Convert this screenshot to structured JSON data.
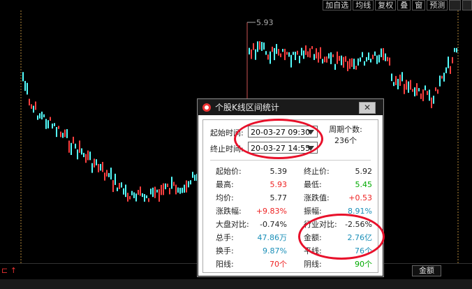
{
  "toolbar": {
    "items": [
      "加自选",
      "均线",
      "复权",
      "叠",
      "窗",
      "预测"
    ],
    "arrow_glyph": "⇒",
    "dropdown_glyph": "▾"
  },
  "chart": {
    "high_label": "5.93",
    "up_color": "#ff4040",
    "down_color": "#54ffff"
  },
  "dialog": {
    "title": "个股K线区间统计",
    "close_glyph": "✕",
    "start_label": "起始时间:",
    "end_label": "终止时间:",
    "start_value": "20-03-27 09:30",
    "end_value": "20-03-27 14:55",
    "period_label": "周期个数:",
    "period_value": "236个",
    "stats_left": [
      {
        "label": "起始价:",
        "value": "5.39",
        "color": "dark"
      },
      {
        "label": "最高:",
        "value": "5.93",
        "color": "red"
      },
      {
        "label": "均价:",
        "value": "5.77",
        "color": "dark"
      },
      {
        "label": "涨跌幅:",
        "value": "+9.83%",
        "color": "red"
      },
      {
        "label": "大盘对比:",
        "value": "-0.74%",
        "color": "dark"
      },
      {
        "label": "总手:",
        "value": "47.86万",
        "color": "blue"
      },
      {
        "label": "换手:",
        "value": "9.87%",
        "color": "blue"
      },
      {
        "label": "阳线:",
        "value": "70个",
        "color": "red"
      }
    ],
    "stats_right": [
      {
        "label": "终止价:",
        "value": "5.92",
        "color": "dark"
      },
      {
        "label": "最低:",
        "value": "5.45",
        "color": "green"
      },
      {
        "label": "涨跌值:",
        "value": "+0.53",
        "color": "red"
      },
      {
        "label": "振幅:",
        "value": "8.91%",
        "color": "blue"
      },
      {
        "label": "行业对比:",
        "value": "-2.56%",
        "color": "dark"
      },
      {
        "label": "金额:",
        "value": "2.76亿",
        "color": "blue"
      },
      {
        "label": "平线:",
        "value": "76个",
        "color": "blue"
      },
      {
        "label": "阴线:",
        "value": "90个",
        "color": "green"
      }
    ]
  },
  "bottom": {
    "amount_button": "金额",
    "nav_glyph": "⊏ ↑"
  }
}
